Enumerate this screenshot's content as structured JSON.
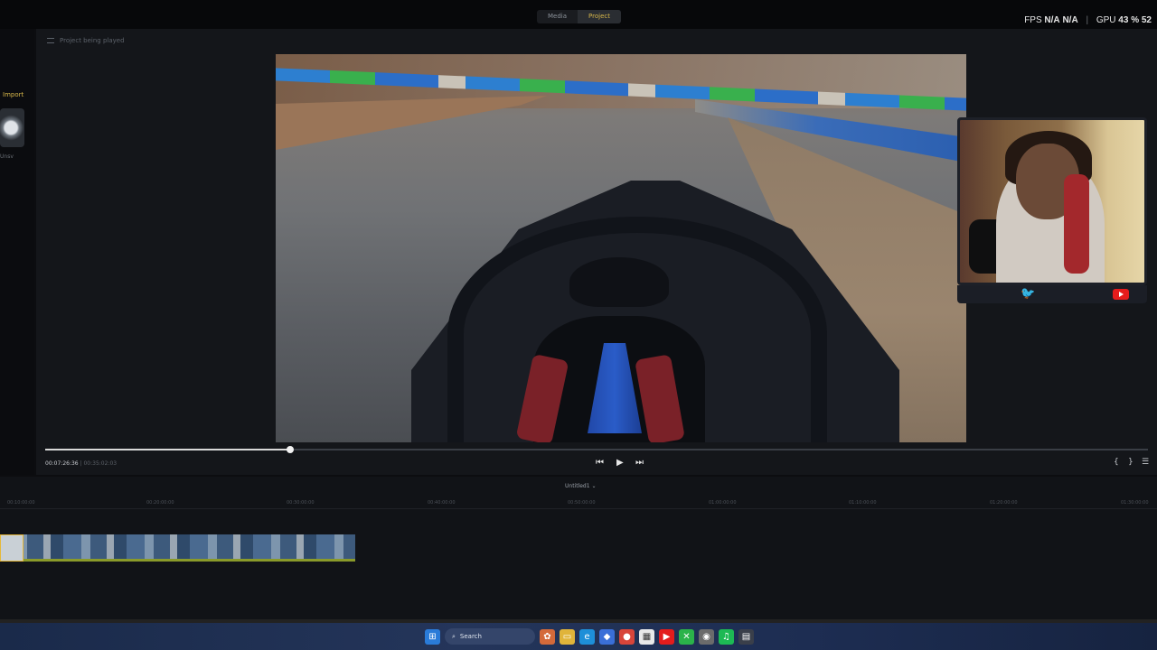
{
  "topbar": {
    "tabs": [
      {
        "label": "Media",
        "active": false
      },
      {
        "label": "Project",
        "active": true
      }
    ],
    "stats": {
      "fps_label": "FPS",
      "fps_value_1": "N/A",
      "fps_value_2": "N/A",
      "gpu_label": "GPU",
      "gpu_value": "43 %",
      "gpu_extra": "52"
    }
  },
  "sidebar": {
    "import_label": "Import",
    "thumb_caption": "Unsv"
  },
  "preview": {
    "title": "Project being played",
    "current_time": "00:07:26:36",
    "duration": "00:35:02:03",
    "progress": 0.222
  },
  "timeline": {
    "sequence_name": "Untitled1 ⌄",
    "ruler_ticks": [
      "00:10:00:00",
      "00:20:00:00",
      "00:30:00:00",
      "00:40:00:00",
      "00:50:00:00",
      "01:00:00:00",
      "01:10:00:00",
      "01:20:00:00",
      "01:30:00:00"
    ]
  },
  "taskbar": {
    "search_label": "Search"
  },
  "colors": {
    "accent": "#d8b84a",
    "twitter": "#5cc7ff",
    "youtube": "#e41c1c"
  },
  "icons": [
    "menu-icon",
    "prev-frame-icon",
    "play-icon",
    "next-frame-icon",
    "mark-in-icon",
    "mark-out-icon",
    "settings-icon",
    "twitter-icon",
    "youtube-icon",
    "windows-icon",
    "search-icon"
  ]
}
